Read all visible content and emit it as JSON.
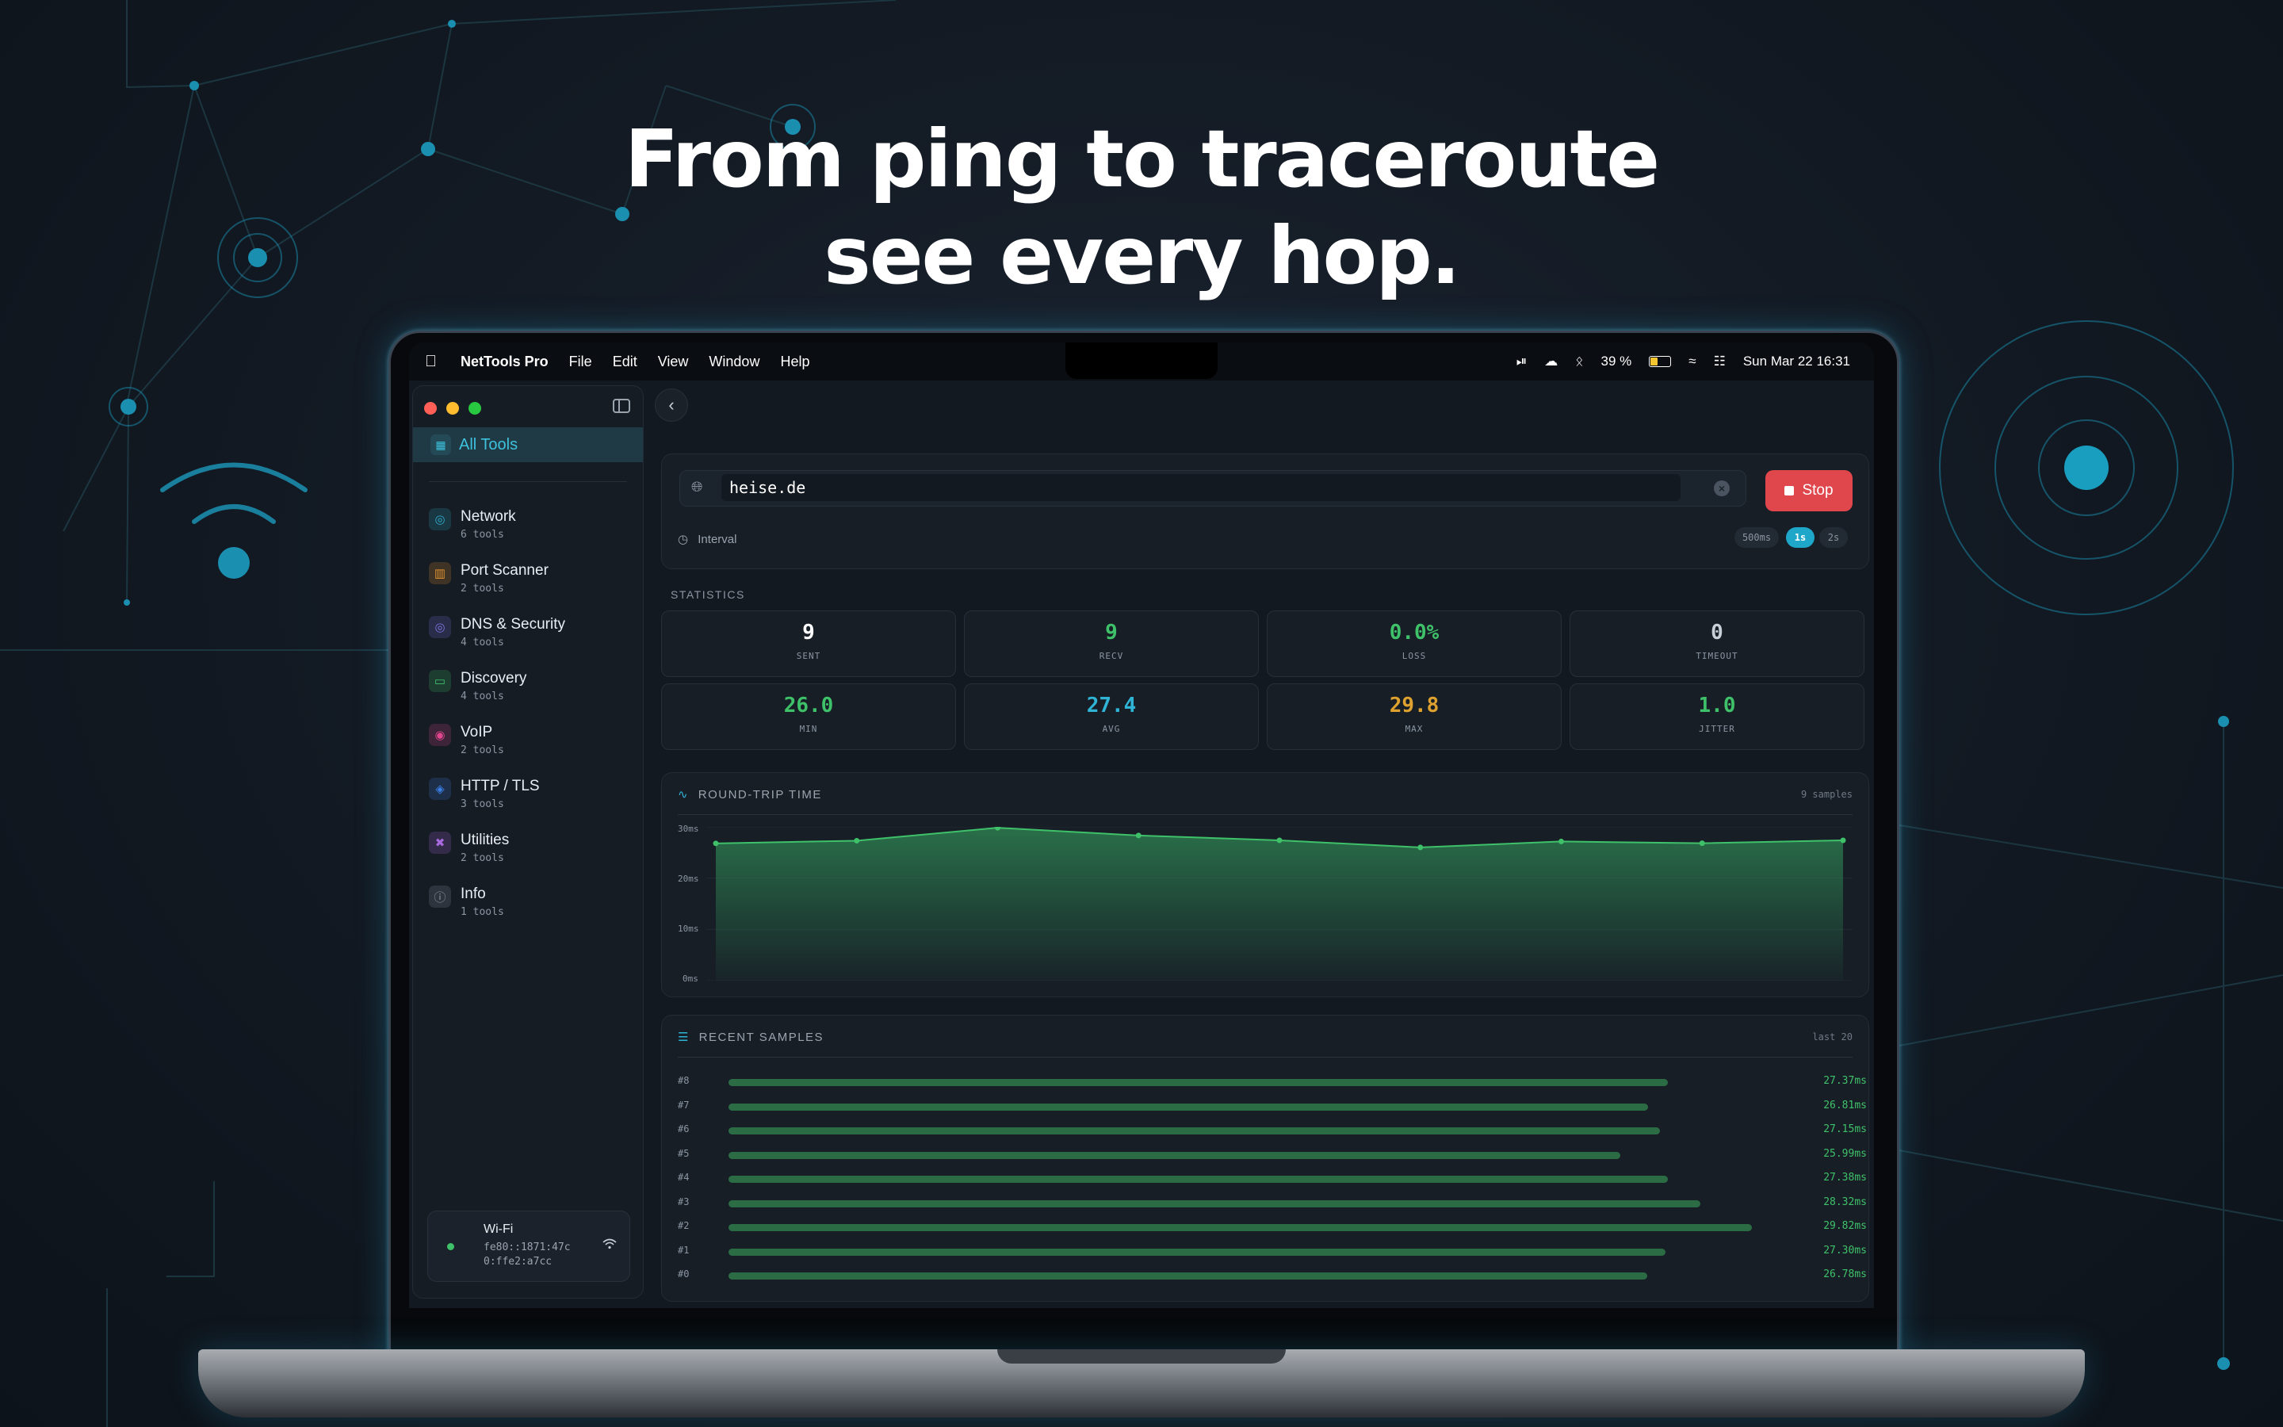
{
  "headline": {
    "line1": "From ping to traceroute",
    "line2": "see every hop."
  },
  "menubar": {
    "app": "NetTools Pro",
    "menus": [
      "File",
      "Edit",
      "View",
      "Window",
      "Help"
    ],
    "battery": "39 %",
    "datetime": "Sun Mar 22  16:31"
  },
  "sidebar": {
    "all_tools": "All Tools",
    "items": [
      {
        "name": "Network",
        "count": "6 tools",
        "icon": "globe-icon",
        "color": "#2fa8c8"
      },
      {
        "name": "Port Scanner",
        "count": "2 tools",
        "icon": "port-icon",
        "color": "#e0912f"
      },
      {
        "name": "DNS & Security",
        "count": "4 tools",
        "icon": "dns-globe-icon",
        "color": "#7a74e0"
      },
      {
        "name": "Discovery",
        "count": "4 tools",
        "icon": "monitor-icon",
        "color": "#3fc16a"
      },
      {
        "name": "VoIP",
        "count": "2 tools",
        "icon": "voip-icon",
        "color": "#e0478f"
      },
      {
        "name": "HTTP / TLS",
        "count": "3 tools",
        "icon": "shield-icon",
        "color": "#3a7de0"
      },
      {
        "name": "Utilities",
        "count": "2 tools",
        "icon": "tools-icon",
        "color": "#a96ae0"
      },
      {
        "name": "Info",
        "count": "1 tools",
        "icon": "info-icon",
        "color": "#8b96a3"
      }
    ],
    "wifi": {
      "title": "Wi-Fi",
      "addr1": "fe80::1871:47c",
      "addr2": "0:ffe2:a7cc"
    }
  },
  "ping": {
    "host": "heise.de",
    "stop_label": "Stop",
    "interval_label": "Interval",
    "interval_options": [
      "500ms",
      "1s",
      "2s"
    ],
    "interval_selected": "1s"
  },
  "statistics": {
    "title": "STATISTICS",
    "cards": [
      {
        "value": "9",
        "label": "SENT",
        "color": "#ffffff"
      },
      {
        "value": "9",
        "label": "RECV",
        "color": "#3fc16a"
      },
      {
        "value": "0.0%",
        "label": "LOSS",
        "color": "#3fc16a"
      },
      {
        "value": "0",
        "label": "TIMEOUT",
        "color": "#c7d0d9"
      },
      {
        "value": "26.0",
        "label": "MIN",
        "color": "#3fc16a"
      },
      {
        "value": "27.4",
        "label": "AVG",
        "color": "#2fb4d6"
      },
      {
        "value": "29.8",
        "label": "MAX",
        "color": "#e0a22f"
      },
      {
        "value": "1.0",
        "label": "JITTER",
        "color": "#3fc16a"
      }
    ]
  },
  "rtt": {
    "title": "ROUND-TRIP TIME",
    "meta": "9 samples",
    "y_ticks": [
      "30ms",
      "20ms",
      "10ms",
      "0ms"
    ]
  },
  "chart_data": {
    "type": "area",
    "title": "ROUND-TRIP TIME",
    "x": [
      0,
      1,
      2,
      3,
      4,
      5,
      6,
      7,
      8
    ],
    "values": [
      26.78,
      27.3,
      29.82,
      28.32,
      27.38,
      25.99,
      27.15,
      26.81,
      27.37
    ],
    "ylim": [
      0,
      30
    ],
    "ylabel": "",
    "xlabel": "",
    "grid": true,
    "color": "#3fc16a"
  },
  "samples": {
    "title": "RECENT SAMPLES",
    "meta": "last 20",
    "rows": [
      {
        "id": "#8",
        "ms": "27.37ms",
        "value": 27.37
      },
      {
        "id": "#7",
        "ms": "26.81ms",
        "value": 26.81
      },
      {
        "id": "#6",
        "ms": "27.15ms",
        "value": 27.15
      },
      {
        "id": "#5",
        "ms": "25.99ms",
        "value": 25.99
      },
      {
        "id": "#4",
        "ms": "27.38ms",
        "value": 27.38
      },
      {
        "id": "#3",
        "ms": "28.32ms",
        "value": 28.32
      },
      {
        "id": "#2",
        "ms": "29.82ms",
        "value": 29.82
      },
      {
        "id": "#1",
        "ms": "27.30ms",
        "value": 27.3
      },
      {
        "id": "#0",
        "ms": "26.78ms",
        "value": 26.78
      }
    ]
  }
}
